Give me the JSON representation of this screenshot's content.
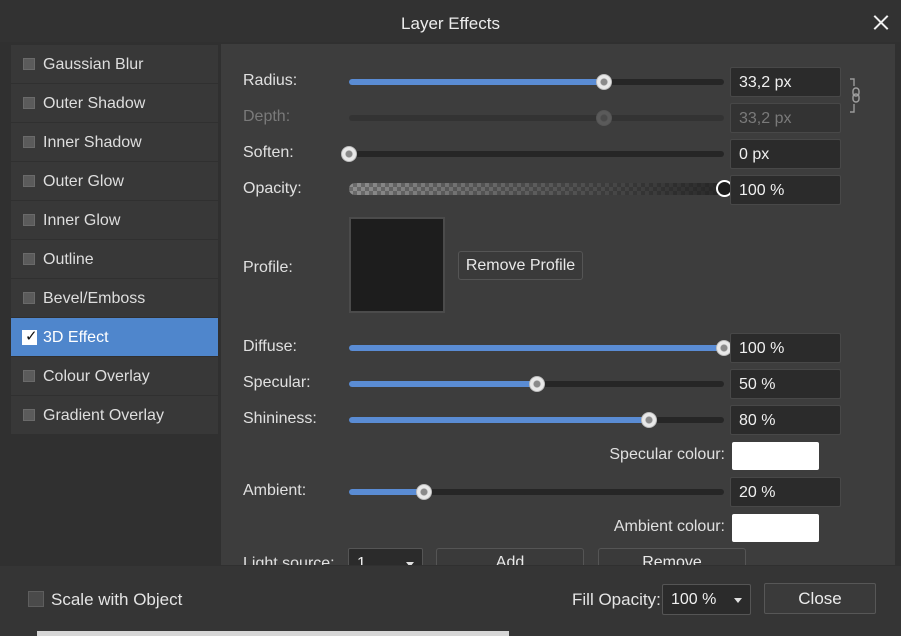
{
  "window": {
    "title": "Layer Effects"
  },
  "sidebar": {
    "items": [
      {
        "label": "Gaussian Blur",
        "checked": false
      },
      {
        "label": "Outer Shadow",
        "checked": false
      },
      {
        "label": "Inner Shadow",
        "checked": false
      },
      {
        "label": "Outer Glow",
        "checked": false
      },
      {
        "label": "Inner Glow",
        "checked": false
      },
      {
        "label": "Outline",
        "checked": false
      },
      {
        "label": "Bevel/Emboss",
        "checked": false
      },
      {
        "label": "3D Effect",
        "checked": true
      },
      {
        "label": "Colour Overlay",
        "checked": false
      },
      {
        "label": "Gradient Overlay",
        "checked": false
      }
    ]
  },
  "panel": {
    "radius": {
      "label": "Radius:",
      "value": "33,2 px",
      "fraction": 0.68
    },
    "depth": {
      "label": "Depth:",
      "value": "33,2 px",
      "fraction": 0.68,
      "disabled": true
    },
    "soften": {
      "label": "Soften:",
      "value": "0 px",
      "fraction": 0.0
    },
    "opacity": {
      "label": "Opacity:",
      "value": "100 %",
      "fraction": 1.0
    },
    "profile": {
      "label": "Profile:",
      "remove_label": "Remove Profile"
    },
    "diffuse": {
      "label": "Diffuse:",
      "value": "100 %",
      "fraction": 1.0
    },
    "specular": {
      "label": "Specular:",
      "value": "50 %",
      "fraction": 0.5
    },
    "shininess": {
      "label": "Shininess:",
      "value": "80 %",
      "fraction": 0.8
    },
    "specular_colour": {
      "label": "Specular colour:",
      "color": "#ffffff"
    },
    "ambient": {
      "label": "Ambient:",
      "value": "20 %",
      "fraction": 0.2
    },
    "ambient_colour": {
      "label": "Ambient colour:",
      "color": "#ffffff"
    },
    "light_source": {
      "label": "Light source:",
      "value": "1",
      "add_label": "Add",
      "remove_label": "Remove"
    }
  },
  "footer": {
    "scale_label": "Scale with Object",
    "scale_checked": false,
    "fill_opacity_label": "Fill Opacity:",
    "fill_opacity_value": "100 %",
    "close_label": "Close"
  },
  "colors": {
    "accent": "#5a8cd4",
    "selection": "#4f86cc"
  },
  "icons": {
    "close": "close-icon",
    "link": "link-chain-icon",
    "checkbox": "check-icon"
  }
}
